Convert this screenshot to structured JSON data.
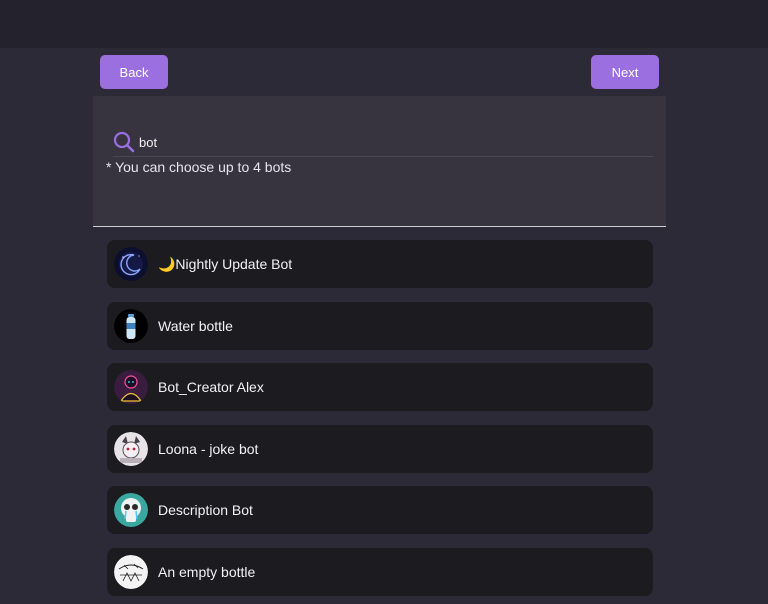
{
  "nav": {
    "back_label": "Back",
    "next_label": "Next"
  },
  "search": {
    "value": "bot",
    "hint": "* You can choose up to 4 bots"
  },
  "bots": [
    {
      "name": "🌙Nightly Update Bot",
      "avatar": "crescent-moon-avatar"
    },
    {
      "name": "Water bottle",
      "avatar": "water-bottle-avatar"
    },
    {
      "name": "Bot_Creator Alex",
      "avatar": "neon-figure-avatar"
    },
    {
      "name": "Loona - joke bot",
      "avatar": "wolf-character-avatar"
    },
    {
      "name": "Description Bot",
      "avatar": "crying-skull-avatar"
    },
    {
      "name": "An empty bottle",
      "avatar": "sketch-drawing-avatar"
    }
  ],
  "colors": {
    "accent": "#9b6fe0",
    "background": "#2c2a36",
    "card": "#1c1b20"
  }
}
